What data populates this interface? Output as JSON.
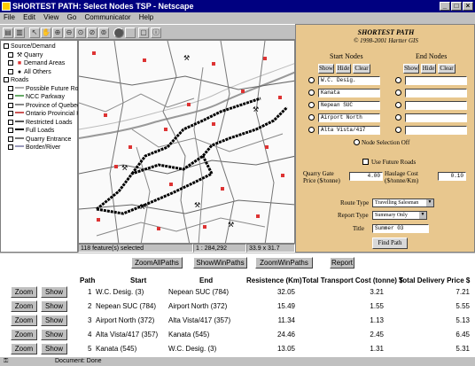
{
  "window": {
    "title": "SHORTEST PATH: Select Nodes TSP - Netscape"
  },
  "menu": [
    "File",
    "Edit",
    "View",
    "Go",
    "Communicator",
    "Help"
  ],
  "toolbar": {
    "brand": "autodesk"
  },
  "legend": {
    "items": [
      {
        "label": "Source/Demand",
        "type": "group"
      },
      {
        "label": "Quarry",
        "type": "sub"
      },
      {
        "label": "Demand Areas",
        "type": "sub"
      },
      {
        "label": "All Others",
        "type": "sub"
      },
      {
        "label": "Roads",
        "type": "group"
      },
      {
        "label": "Possible Future Roads",
        "type": "sub"
      },
      {
        "label": "NCC Parkway",
        "type": "sub"
      },
      {
        "label": "Province of Quebec",
        "type": "sub"
      },
      {
        "label": "Ontario Provincial Hwy",
        "type": "sub"
      },
      {
        "label": "Restricted Loads",
        "type": "sub"
      },
      {
        "label": "Full Loads",
        "type": "sub"
      },
      {
        "label": "Quarry Entrance",
        "type": "sub"
      },
      {
        "label": "Border/River",
        "type": "sub"
      }
    ]
  },
  "map_status": {
    "selected": "118 feature(s) selected",
    "coords": "1 : 284,292",
    "size": "33.9 x 31.7 (Km)"
  },
  "panel": {
    "title": "SHORTEST PATH",
    "copyright": "© 1998-2001 Hartter GIS",
    "start_header": "Start Nodes",
    "end_header": "End Nodes",
    "show": "Show",
    "hide": "Hide",
    "clear": "Clear",
    "start_nodes": [
      "W.C. Desig.",
      "Kanata",
      "Nepean SUC",
      "Airport North",
      "Alta Vista/417"
    ],
    "end_nodes": [
      "",
      "",
      "",
      "",
      ""
    ],
    "node_selection": "Node Selection Off",
    "future_roads": "Use Future Roads",
    "quarry_gate_label": "Quarry Gate Price ($/tonne)",
    "quarry_gate_value": "4.00",
    "haulage_label": "Haulage Cost ($/tonne/Km)",
    "haulage_value": "0.10",
    "route_type_label": "Route Type",
    "route_type_value": "Travelling Salesman",
    "report_type_label": "Report Type",
    "report_type_value": "Summary Only",
    "title_label": "Title",
    "title_value": "Summer 03",
    "find_path": "Find Path"
  },
  "results": {
    "buttons": [
      "ZoomAllPaths",
      "ShowWinPaths",
      "ZoomWinPaths",
      "Report"
    ],
    "columns": [
      "Path",
      "Start",
      "End",
      "Resistence (Km)",
      "Total Transport Cost (tonne) $",
      "Total Delivery Price $"
    ],
    "zoom": "Zoom",
    "show": "Show",
    "rows": [
      {
        "path": "1",
        "start": "W.C. Desig. (3)",
        "end": "Nepean SUC (784)",
        "res": "32.05",
        "cost": "3.21",
        "price": "7.21"
      },
      {
        "path": "2",
        "start": "Nepean SUC (784)",
        "end": "Airport North (372)",
        "res": "15.49",
        "cost": "1.55",
        "price": "5.55"
      },
      {
        "path": "3",
        "start": "Airport North (372)",
        "end": "Alta Vista/417 (357)",
        "res": "11.34",
        "cost": "1.13",
        "price": "5.13"
      },
      {
        "path": "4",
        "start": "Alta Vista/417 (357)",
        "end": "Kanata (545)",
        "res": "24.46",
        "cost": "2.45",
        "price": "6.45"
      },
      {
        "path": "5",
        "start": "Kanata (545)",
        "end": "W.C. Desig. (3)",
        "res": "13.05",
        "cost": "1.31",
        "price": "5.31"
      }
    ]
  },
  "status": {
    "text": "Document: Done"
  }
}
